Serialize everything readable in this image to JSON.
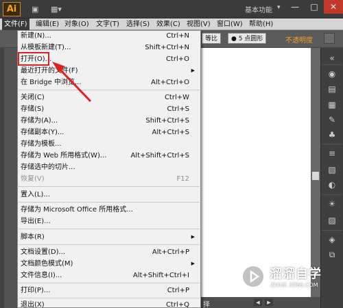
{
  "app": {
    "logo": "Ai",
    "workspace": "基本功能",
    "accent_color": "#f7a21b"
  },
  "window": {
    "minimize": "—",
    "maximize": "□",
    "close": "✕"
  },
  "menubar": {
    "items": [
      "文件(F)",
      "编辑(E)",
      "对象(O)",
      "文字(T)",
      "选择(S)",
      "效果(C)",
      "视图(V)",
      "窗口(W)",
      "帮助(H)"
    ],
    "active_index": 0
  },
  "controlbar": {
    "stroke_label": "等比",
    "brush_label": "● 5 点圆形",
    "opacity_label": "不透明度"
  },
  "file_menu": {
    "items": [
      {
        "label": "新建(N)...",
        "shortcut": "Ctrl+N"
      },
      {
        "label": "从模板新建(T)...",
        "shortcut": "Shift+Ctrl+N"
      },
      {
        "label": "打开(O)...",
        "shortcut": "Ctrl+O"
      },
      {
        "label": "最近打开的文件(F)",
        "shortcut": "",
        "submenu": "▶"
      },
      {
        "label": "在 Bridge 中浏览...",
        "shortcut": "Alt+Ctrl+O"
      },
      {
        "label": "关闭(C)",
        "shortcut": "Ctrl+W"
      },
      {
        "label": "存储(S)",
        "shortcut": "Ctrl+S"
      },
      {
        "label": "存储为(A)...",
        "shortcut": "Shift+Ctrl+S"
      },
      {
        "label": "存储副本(Y)...",
        "shortcut": "Alt+Ctrl+S"
      },
      {
        "label": "存储为模板...",
        "shortcut": ""
      },
      {
        "label": "存储为 Web 所用格式(W)...",
        "shortcut": "Alt+Shift+Ctrl+S"
      },
      {
        "label": "存储选中的切片...",
        "shortcut": ""
      },
      {
        "label": "恢复(V)",
        "shortcut": "F12"
      },
      {
        "label": "置入(L)...",
        "shortcut": ""
      },
      {
        "label": "存储为 Microsoft Office 所用格式...",
        "shortcut": ""
      },
      {
        "label": "导出(E)...",
        "shortcut": ""
      },
      {
        "label": "脚本(R)",
        "shortcut": "",
        "submenu": "▶"
      },
      {
        "label": "文档设置(D)...",
        "shortcut": "Alt+Ctrl+P"
      },
      {
        "label": "文档颜色模式(M)",
        "shortcut": "",
        "submenu": "▶"
      },
      {
        "label": "文件信息(I)...",
        "shortcut": "Alt+Shift+Ctrl+I"
      },
      {
        "label": "打印(P)...",
        "shortcut": "Ctrl+P"
      },
      {
        "label": "退出(X)",
        "shortcut": "Ctrl+Q"
      }
    ]
  },
  "status": {
    "text": "择",
    "prev": "◀",
    "next": "▶"
  },
  "watermark": {
    "title": "溜溜自学",
    "subtitle": "ZIXUE.3D66.COM"
  }
}
